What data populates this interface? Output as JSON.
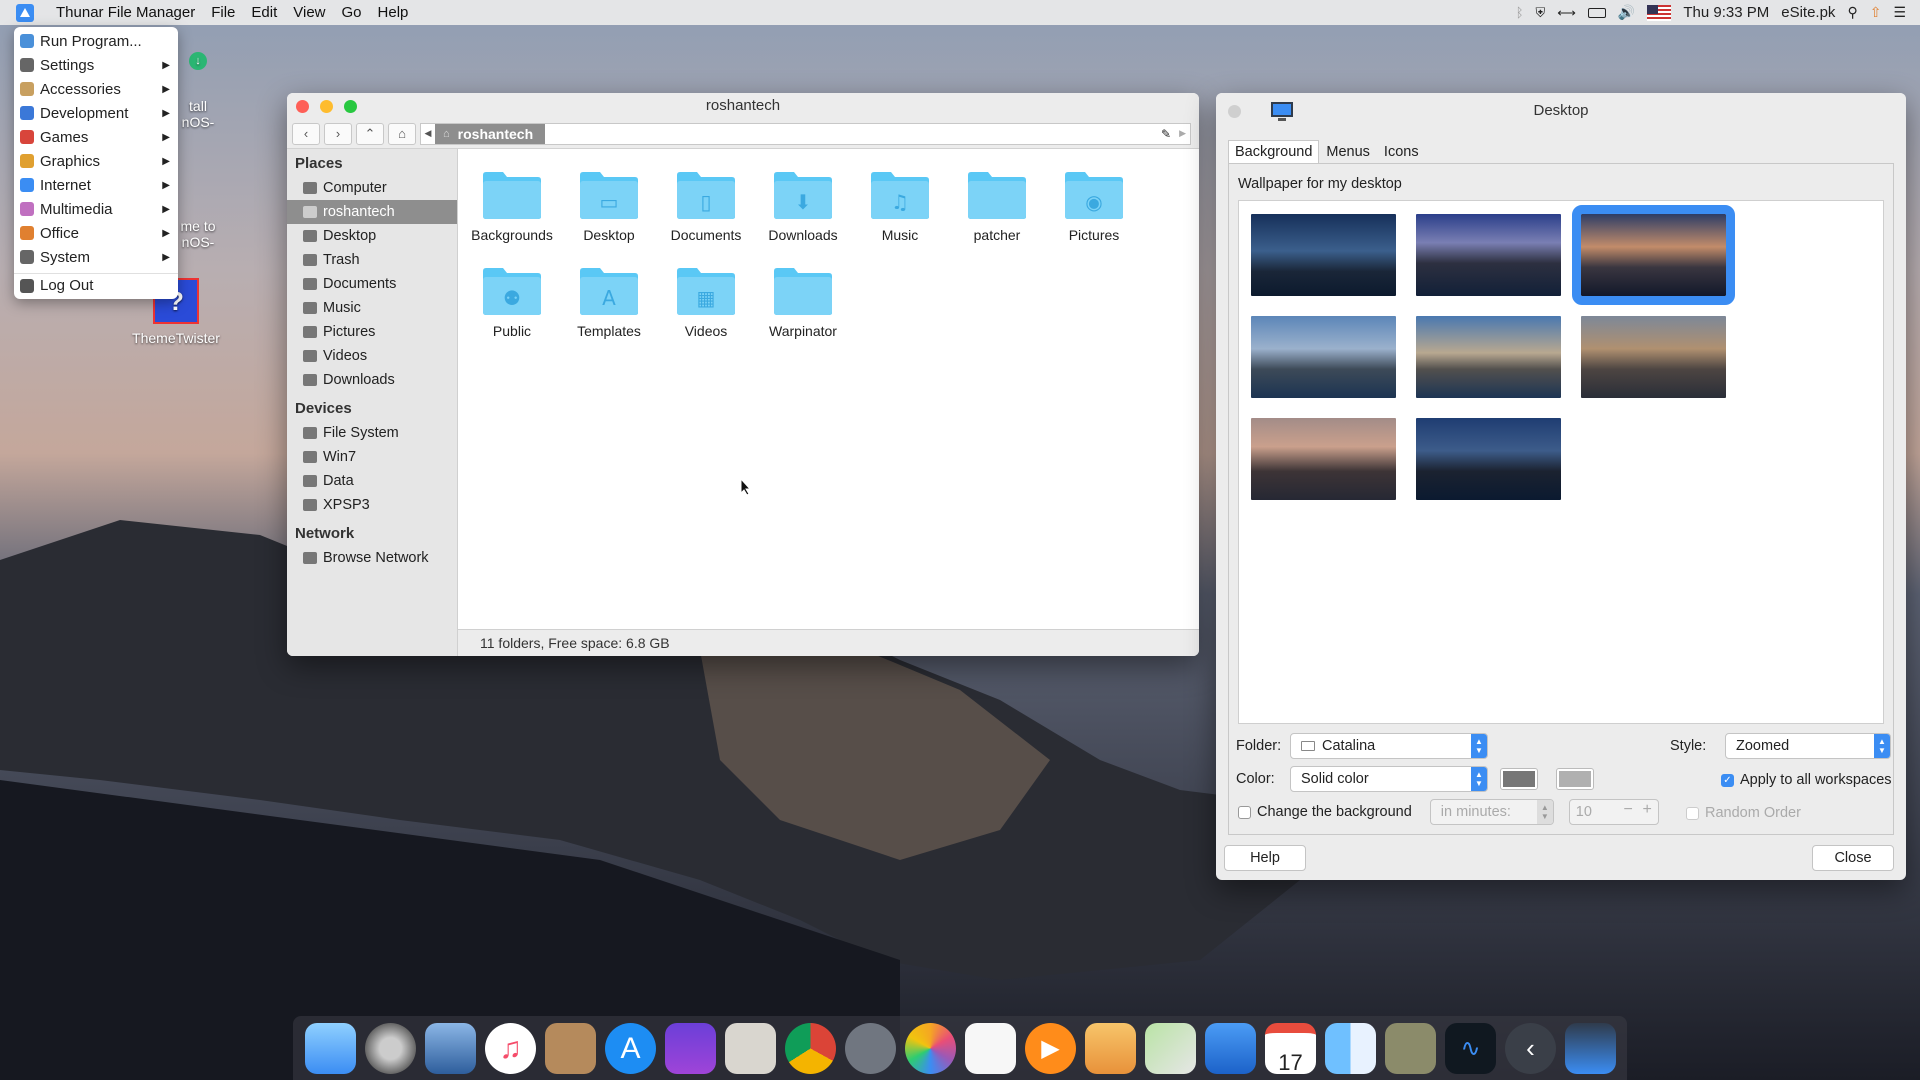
{
  "menubar": {
    "app_name": "Thunar File Manager",
    "menus": [
      "File",
      "Edit",
      "View",
      "Go",
      "Help"
    ],
    "clock": "Thu  9:33 PM",
    "user": "eSite.pk"
  },
  "app_menu": {
    "items": [
      {
        "label": "Run Program...",
        "submenu": false,
        "icon": "search-icon",
        "color": "#4a90d9"
      },
      {
        "label": "Settings",
        "submenu": true,
        "icon": "settings-icon",
        "color": "#666666"
      },
      {
        "label": "Accessories",
        "submenu": true,
        "icon": "accessories-icon",
        "color": "#c8a060"
      },
      {
        "label": "Development",
        "submenu": true,
        "icon": "development-icon",
        "color": "#3b78d8"
      },
      {
        "label": "Games",
        "submenu": true,
        "icon": "games-icon",
        "color": "#d8453b"
      },
      {
        "label": "Graphics",
        "submenu": true,
        "icon": "graphics-icon",
        "color": "#e0a030"
      },
      {
        "label": "Internet",
        "submenu": true,
        "icon": "internet-icon",
        "color": "#3b8df3"
      },
      {
        "label": "Multimedia",
        "submenu": true,
        "icon": "multimedia-icon",
        "color": "#c070c0"
      },
      {
        "label": "Office",
        "submenu": true,
        "icon": "office-icon",
        "color": "#e08030"
      },
      {
        "label": "System",
        "submenu": true,
        "icon": "system-icon",
        "color": "#666666"
      },
      {
        "label": "Log Out",
        "submenu": false,
        "icon": "logout-icon",
        "color": "#555555"
      }
    ]
  },
  "desktop_icons": {
    "theme_twister": "ThemeTwister",
    "partial_1a": "tall",
    "partial_1b": "nOS-",
    "partial_2a": "me to",
    "partial_2b": "nOS-"
  },
  "thunar": {
    "title": "roshantech",
    "path_segment": "roshantech",
    "places_header": "Places",
    "places": [
      "Computer",
      "roshantech",
      "Desktop",
      "Trash",
      "Documents",
      "Music",
      "Pictures",
      "Videos",
      "Downloads"
    ],
    "devices_header": "Devices",
    "devices": [
      "File System",
      "Win7",
      "Data",
      "XPSP3"
    ],
    "network_header": "Network",
    "network": [
      "Browse Network"
    ],
    "folders": [
      "Backgrounds",
      "Desktop",
      "Documents",
      "Downloads",
      "Music",
      "patcher",
      "Pictures",
      "Public",
      "Templates",
      "Videos",
      "Warpinator"
    ],
    "status": "11 folders, Free space: 6.8 GB"
  },
  "desktop_settings": {
    "title": "Desktop",
    "tabs": [
      "Background",
      "Menus",
      "Icons"
    ],
    "wallpaper_label": "Wallpaper for my desktop",
    "folder_label": "Folder:",
    "folder_value": "Catalina",
    "style_label": "Style:",
    "style_value": "Zoomed",
    "color_label": "Color:",
    "color_value": "Solid color",
    "apply_all": "Apply to all workspaces",
    "change_bg": "Change the background",
    "in_minutes": "in minutes:",
    "minutes_value": "10",
    "random_order": "Random Order",
    "help_btn": "Help",
    "close_btn": "Close",
    "swatch1": "#777777",
    "swatch2": "#b0b0b0"
  },
  "colors": {
    "accent": "#3b8df3",
    "selection_grey": "#8e8e8e",
    "folder_blue": "#5ac8f5"
  }
}
